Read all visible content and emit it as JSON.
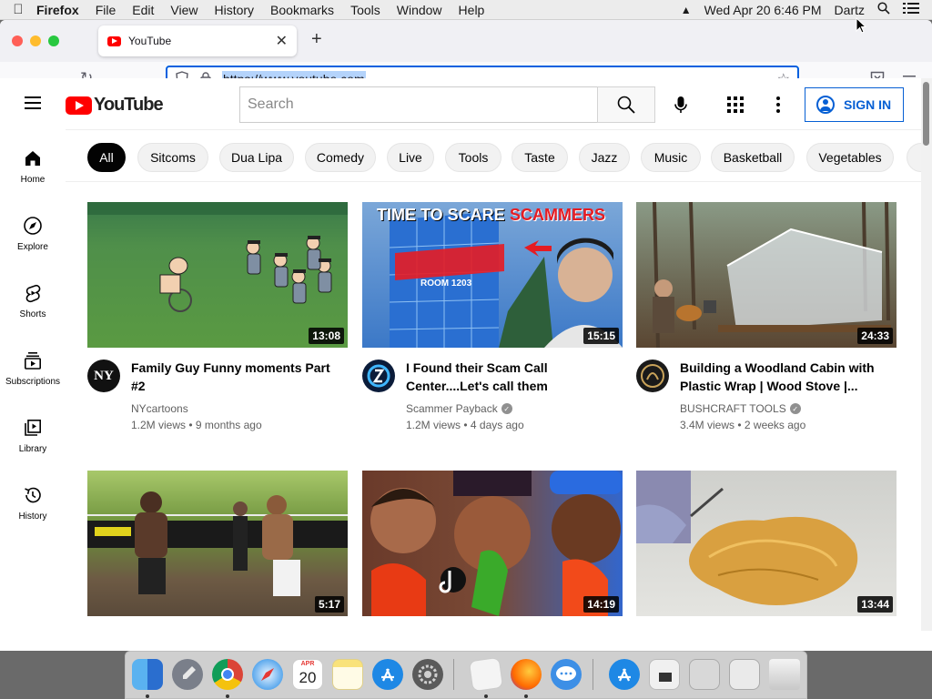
{
  "menubar": {
    "apple": "",
    "app": "Firefox",
    "items": [
      "File",
      "Edit",
      "View",
      "History",
      "Bookmarks",
      "Tools",
      "Window",
      "Help"
    ],
    "datetime": "Wed Apr 20  6:46 PM",
    "user": "Dartz"
  },
  "browser": {
    "tab_title": "YouTube",
    "url": "https://www.youtube.com"
  },
  "youtube": {
    "logo_text": "YouTube",
    "search_placeholder": "Search",
    "sign_in": "SIGN IN",
    "guide": [
      "Home",
      "Explore",
      "Shorts",
      "Subscriptions",
      "Library",
      "History"
    ],
    "chips": [
      "All",
      "Sitcoms",
      "Dua Lipa",
      "Comedy",
      "Live",
      "Tools",
      "Taste",
      "Jazz",
      "Music",
      "Basketball",
      "Vegetables"
    ],
    "videos": [
      {
        "title": "Family Guy Funny moments Part #2",
        "channel": "NYcartoons",
        "verified": false,
        "views": "1.2M views",
        "age": "9 months ago",
        "duration": "13:08",
        "avatar_text": "NY"
      },
      {
        "title": "I Found their Scam Call Center....Let's call them",
        "channel": "Scammer Payback",
        "verified": true,
        "views": "1.2M views",
        "age": "4 days ago",
        "duration": "15:15",
        "avatar_text": "",
        "thumb_text": "TIME TO SCARE",
        "thumb_text2": "SCAMMERS",
        "thumb_room": "ROOM 1203"
      },
      {
        "title": "Building a Woodland Cabin with Plastic Wrap | Wood Stove |...",
        "channel": "BUSHCRAFT TOOLS",
        "verified": true,
        "views": "3.4M views",
        "age": "2 weeks ago",
        "duration": "24:33",
        "avatar_text": ""
      },
      {
        "duration": "5:17"
      },
      {
        "duration": "14:19"
      },
      {
        "duration": "13:44"
      }
    ]
  },
  "dock": {
    "calendar_month": "APR",
    "calendar_day": "20"
  },
  "colors": {
    "youtube_red": "#ff0000",
    "signin_blue": "#065fd4",
    "url_focus": "#0060df"
  }
}
